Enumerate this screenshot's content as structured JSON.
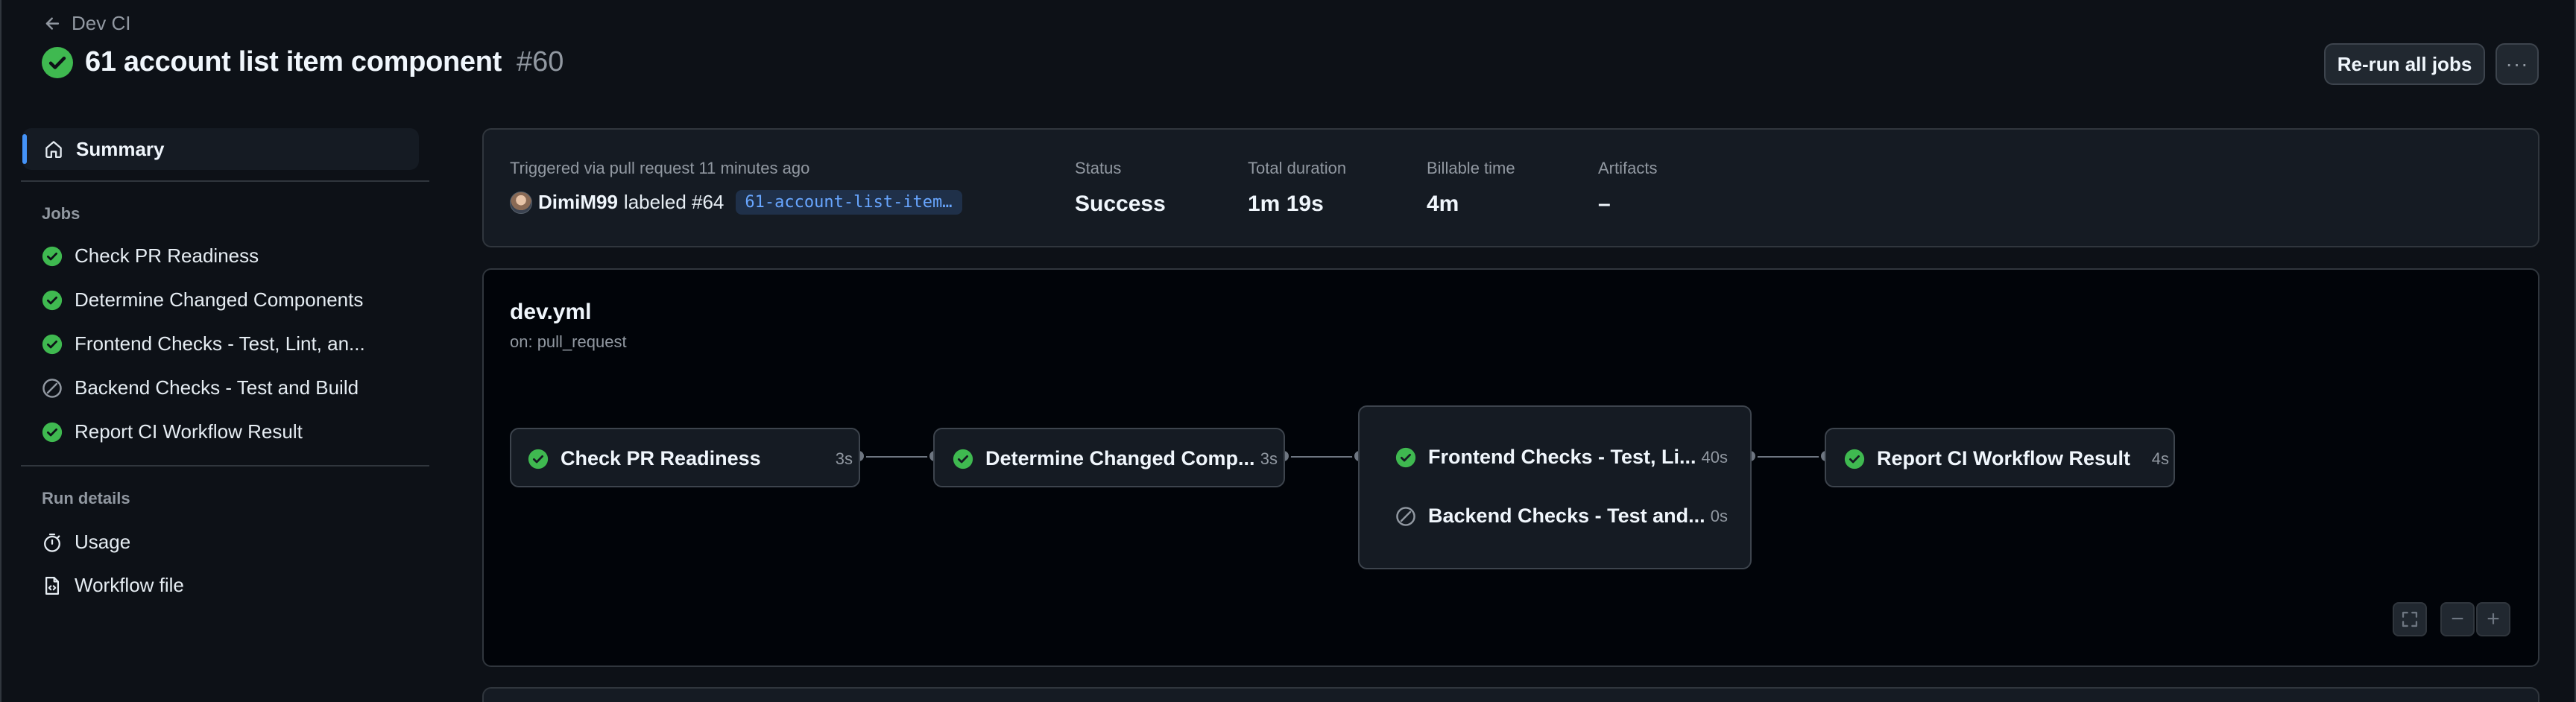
{
  "header": {
    "back_label": "Dev CI",
    "title": "61 account list item component",
    "run_number": "#60",
    "rerun_label": "Re-run all jobs",
    "more_label": "···"
  },
  "sidebar": {
    "summary_label": "Summary",
    "jobs_heading": "Jobs",
    "jobs": [
      {
        "label": "Check PR Readiness",
        "status": "success"
      },
      {
        "label": "Determine Changed Components",
        "status": "success"
      },
      {
        "label": "Frontend Checks - Test, Lint, an...",
        "status": "success"
      },
      {
        "label": "Backend Checks - Test and Build",
        "status": "skipped"
      },
      {
        "label": "Report CI Workflow Result",
        "status": "success"
      }
    ],
    "run_details_heading": "Run details",
    "usage_label": "Usage",
    "workflow_file_label": "Workflow file"
  },
  "summary": {
    "trigger_text": "Triggered via pull request 11 minutes ago",
    "actor": "DimiM99",
    "action_text": "labeled #64",
    "branch": "61-account-list-item-component",
    "status_label": "Status",
    "status_value": "Success",
    "duration_label": "Total duration",
    "duration_value": "1m 19s",
    "billable_label": "Billable time",
    "billable_value": "4m",
    "artifacts_label": "Artifacts",
    "artifacts_value": "–"
  },
  "workflow": {
    "name": "dev.yml",
    "trigger": "on: pull_request",
    "jobs": [
      {
        "name": "Check PR Readiness",
        "duration": "3s",
        "status": "success"
      },
      {
        "name": "Determine Changed Comp...",
        "duration": "3s",
        "status": "success"
      },
      {
        "name": "Frontend Checks - Test, Li...",
        "duration": "40s",
        "status": "success"
      },
      {
        "name": "Backend Checks - Test and...",
        "duration": "0s",
        "status": "skipped"
      },
      {
        "name": "Report CI Workflow Result",
        "duration": "4s",
        "status": "success"
      }
    ],
    "zoom_out_label": "−",
    "zoom_in_label": "+"
  },
  "colors": {
    "success": "#3fb950",
    "skipped": "#9198a1",
    "accent": "#4493f8",
    "background": "#0d1117"
  }
}
